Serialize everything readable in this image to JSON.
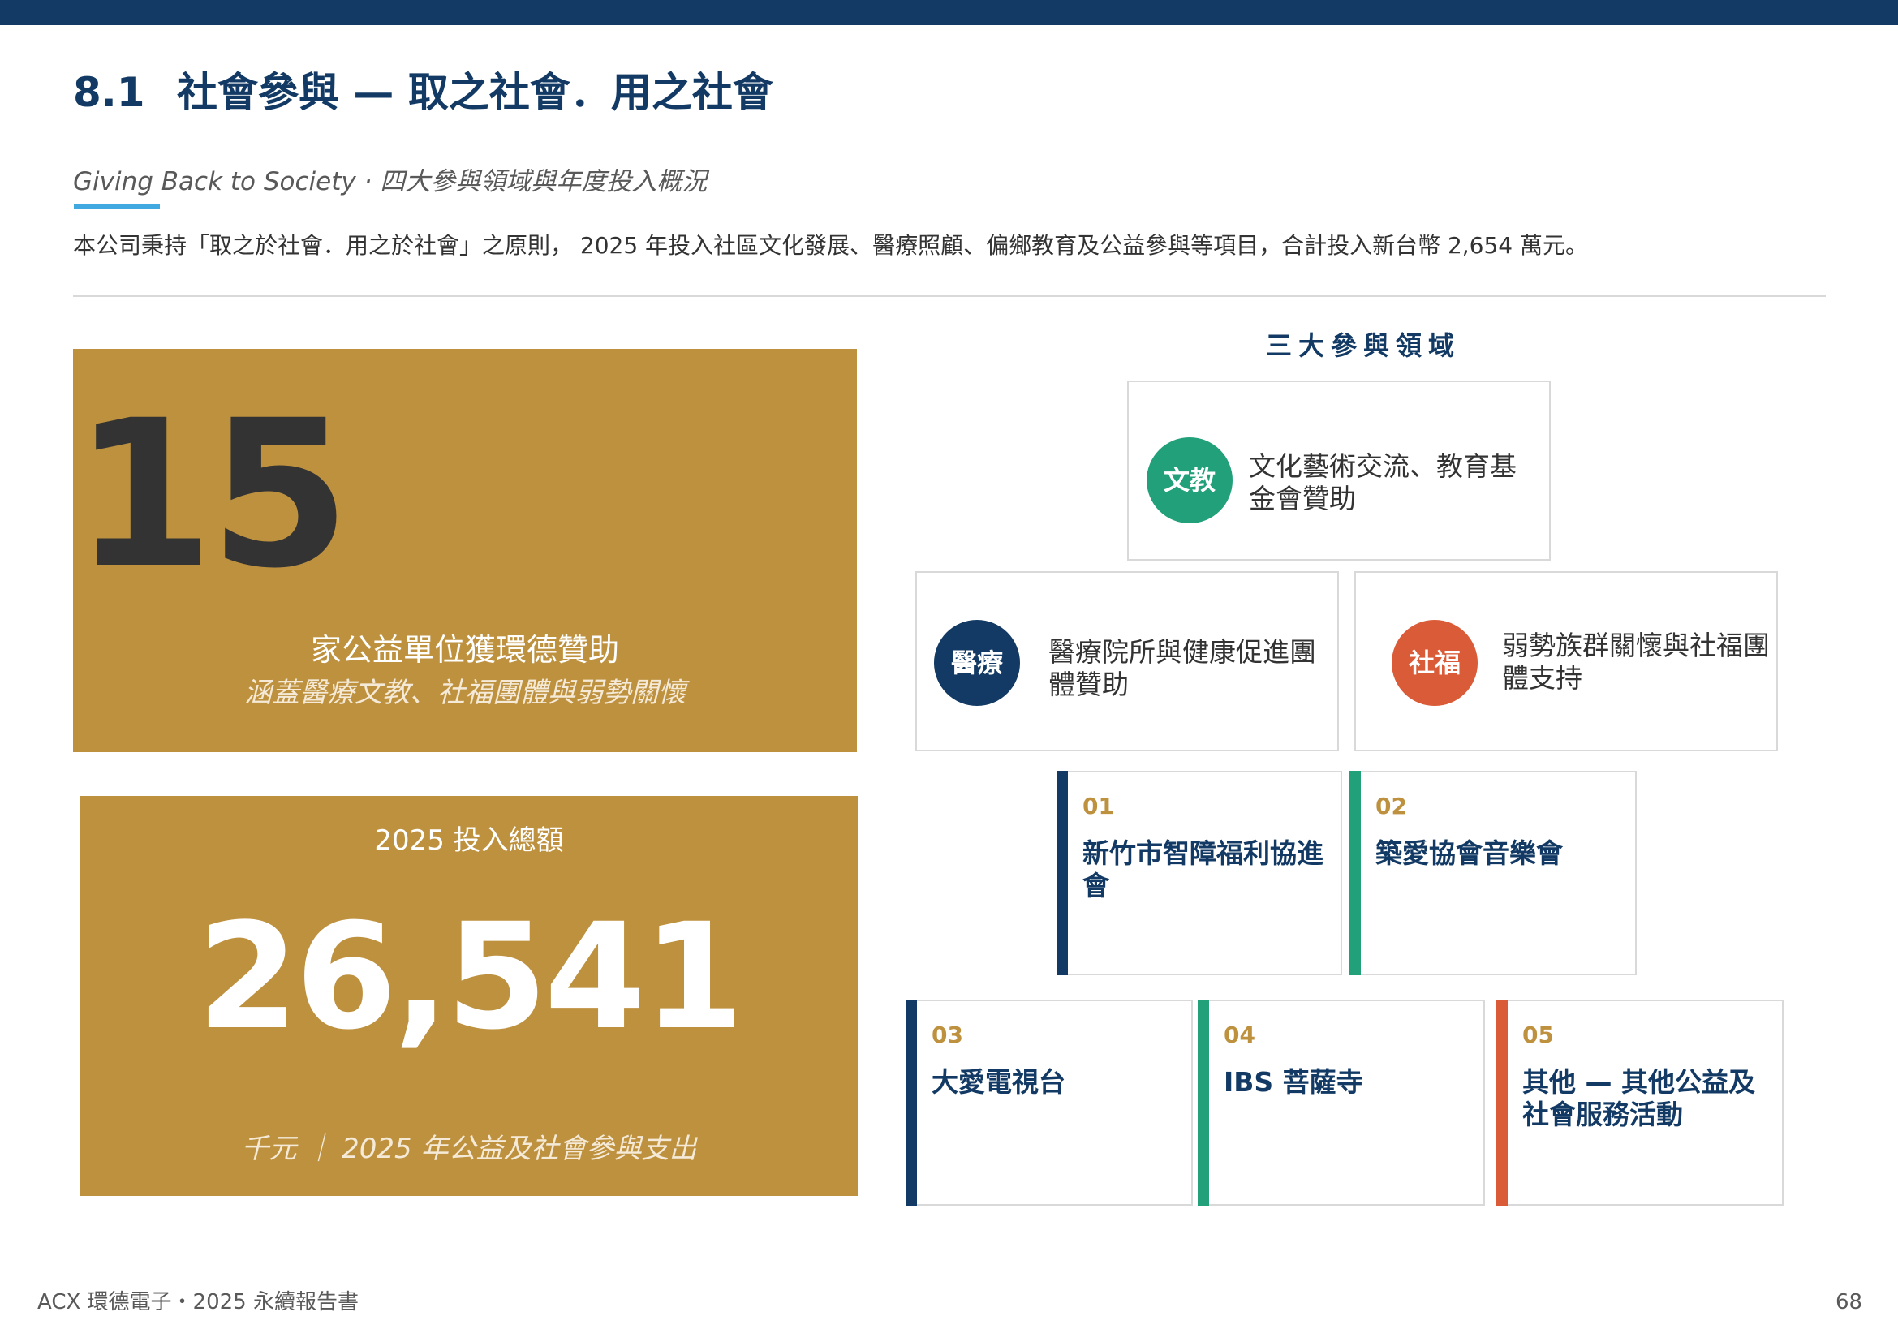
{
  "header": {
    "section_number": "8.1",
    "section_title": "社會參與 — 取之社會．用之社會",
    "subtitle": "Giving Back to Society · 四大參與領域與年度投入概況",
    "intro": "本公司秉持「取之於社會．用之於社會」之原則， 2025 年投入社區文化發展、醫療照顧、偏鄉教育及公益參與等項目，合計投入新台幣 2,654 萬元。"
  },
  "stats": {
    "organizations": {
      "value": "15",
      "label": "家公益單位獲環德贊助",
      "sub": "涵蓋醫療文教、社福團體與弱勢關懷"
    },
    "total": {
      "caption": "2025 投入總額",
      "value": "26,541",
      "sub": "千元 ｜ 2025 年公益及社會參與支出"
    }
  },
  "areas": {
    "heading": "三大參與領域",
    "items": [
      {
        "badge": "文教",
        "text": "文化藝術交流、教育基金會贊助",
        "color": "#22a07a"
      },
      {
        "badge": "醫療",
        "text": "醫療院所與健康促進團體贊助",
        "color": "#123a64"
      },
      {
        "badge": "社福",
        "text": "弱勢族群關懷與社福團體支持",
        "color": "#d95b37"
      }
    ]
  },
  "organizations": [
    {
      "num": "01",
      "name": "新竹市智障福利協進會",
      "color": "#123a64"
    },
    {
      "num": "02",
      "name": "築愛協會音樂會",
      "color": "#22a07a"
    },
    {
      "num": "03",
      "name": "大愛電視台",
      "color": "#123a64"
    },
    {
      "num": "04",
      "name": "IBS 菩薩寺",
      "color": "#22a07a"
    },
    {
      "num": "05",
      "name": "其他 — 其他公益及社會服務活動",
      "color": "#d95b37"
    }
  ],
  "footer": {
    "report": "ACX 環德電子・2025 永續報告書",
    "page": "68"
  }
}
